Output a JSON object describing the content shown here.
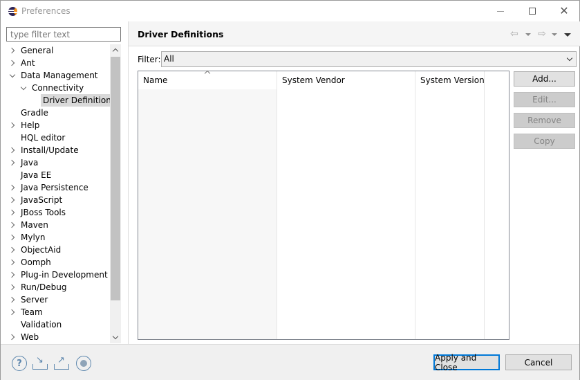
{
  "window": {
    "title": "Preferences"
  },
  "filter": {
    "placeholder": "type filter text"
  },
  "tree": [
    {
      "label": "General",
      "twisty": "collapsed",
      "indent": 0
    },
    {
      "label": "Ant",
      "twisty": "collapsed",
      "indent": 0
    },
    {
      "label": "Data Management",
      "twisty": "expanded",
      "indent": 0
    },
    {
      "label": "Connectivity",
      "twisty": "expanded",
      "indent": 1
    },
    {
      "label": "Driver Definitions",
      "twisty": "none",
      "indent": 2,
      "selected": true
    },
    {
      "label": "Gradle",
      "twisty": "none",
      "indent": 0
    },
    {
      "label": "Help",
      "twisty": "collapsed",
      "indent": 0
    },
    {
      "label": "HQL editor",
      "twisty": "none",
      "indent": 0
    },
    {
      "label": "Install/Update",
      "twisty": "collapsed",
      "indent": 0
    },
    {
      "label": "Java",
      "twisty": "collapsed",
      "indent": 0
    },
    {
      "label": "Java EE",
      "twisty": "none",
      "indent": 0
    },
    {
      "label": "Java Persistence",
      "twisty": "collapsed",
      "indent": 0
    },
    {
      "label": "JavaScript",
      "twisty": "collapsed",
      "indent": 0
    },
    {
      "label": "JBoss Tools",
      "twisty": "collapsed",
      "indent": 0
    },
    {
      "label": "Maven",
      "twisty": "collapsed",
      "indent": 0
    },
    {
      "label": "Mylyn",
      "twisty": "collapsed",
      "indent": 0
    },
    {
      "label": "ObjectAid",
      "twisty": "collapsed",
      "indent": 0
    },
    {
      "label": "Oomph",
      "twisty": "collapsed",
      "indent": 0
    },
    {
      "label": "Plug-in Development",
      "twisty": "collapsed",
      "indent": 0
    },
    {
      "label": "Run/Debug",
      "twisty": "collapsed",
      "indent": 0
    },
    {
      "label": "Server",
      "twisty": "collapsed",
      "indent": 0
    },
    {
      "label": "Team",
      "twisty": "collapsed",
      "indent": 0
    },
    {
      "label": "Validation",
      "twisty": "none",
      "indent": 0
    },
    {
      "label": "Web",
      "twisty": "collapsed",
      "indent": 0
    }
  ],
  "page": {
    "title": "Driver Definitions",
    "filter_label": "Filter:",
    "filter_value": "All"
  },
  "table": {
    "columns": [
      "Name",
      "System Vendor",
      "System Version"
    ],
    "rows": []
  },
  "actions": {
    "add": "Add...",
    "edit": "Edit...",
    "remove": "Remove",
    "copy": "Copy"
  },
  "footer": {
    "apply_close": "Apply and Close",
    "cancel": "Cancel"
  },
  "colors": {
    "selection": "#d9d9d9",
    "focus_border": "#0078d7",
    "icon_blue": "#5c86ad"
  }
}
